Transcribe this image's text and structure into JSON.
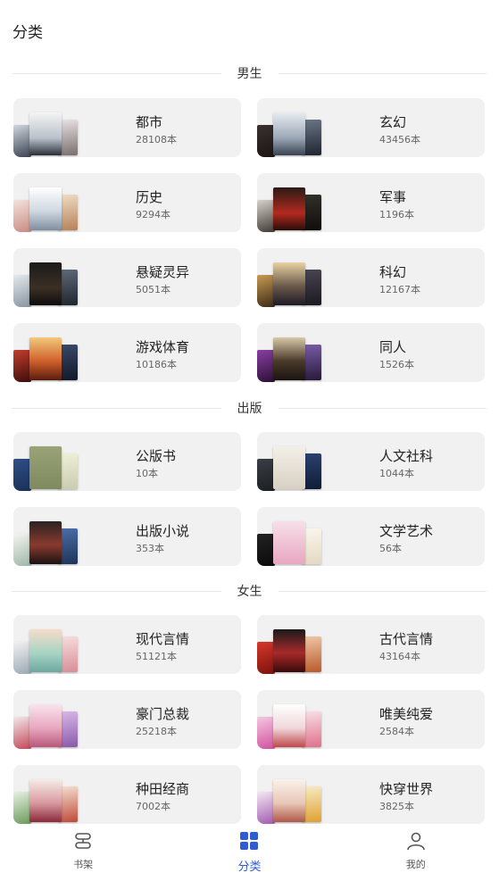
{
  "header": {
    "title": "分类"
  },
  "colors": {
    "accent": "#2f5bd3",
    "card_bg": "#f1f1f1",
    "inactive_tab": "#555555"
  },
  "sections": [
    {
      "title": "男生",
      "items": [
        {
          "name": "都市",
          "count": "28108本"
        },
        {
          "name": "玄幻",
          "count": "43456本"
        },
        {
          "name": "历史",
          "count": "9294本"
        },
        {
          "name": "军事",
          "count": "1196本"
        },
        {
          "name": "悬疑灵异",
          "count": "5051本"
        },
        {
          "name": "科幻",
          "count": "12167本"
        },
        {
          "name": "游戏体育",
          "count": "10186本"
        },
        {
          "name": "同人",
          "count": "1526本"
        }
      ]
    },
    {
      "title": "出版",
      "items": [
        {
          "name": "公版书",
          "count": "10本"
        },
        {
          "name": "人文社科",
          "count": "1044本"
        },
        {
          "name": "出版小说",
          "count": "353本"
        },
        {
          "name": "文学艺术",
          "count": "56本"
        }
      ]
    },
    {
      "title": "女生",
      "items": [
        {
          "name": "现代言情",
          "count": "51121本"
        },
        {
          "name": "古代言情",
          "count": "43164本"
        },
        {
          "name": "豪门总裁",
          "count": "25218本"
        },
        {
          "name": "唯美纯爱",
          "count": "2584本"
        },
        {
          "name": "种田经商",
          "count": "7002本"
        },
        {
          "name": "快穿世界",
          "count": "3825本"
        }
      ]
    }
  ],
  "tabs": [
    {
      "label": "书架",
      "icon": "bookshelf-icon",
      "active": false
    },
    {
      "label": "分类",
      "icon": "grid-icon",
      "active": true
    },
    {
      "label": "我的",
      "icon": "user-icon",
      "active": false
    }
  ]
}
